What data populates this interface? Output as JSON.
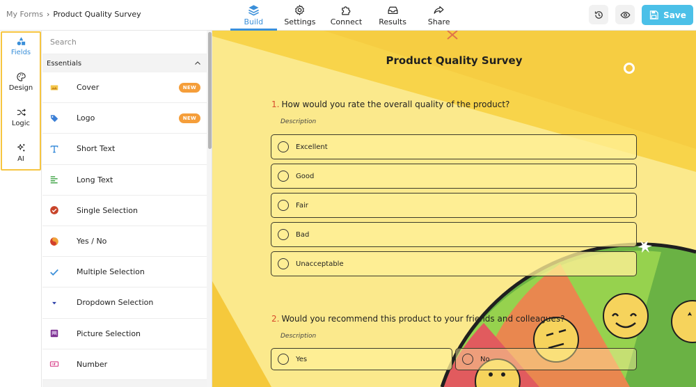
{
  "breadcrumb": {
    "root": "My Forms",
    "current": "Product Quality Survey"
  },
  "nav": {
    "tabs": [
      {
        "label": "Build",
        "icon": "layers-icon",
        "active": true
      },
      {
        "label": "Settings",
        "icon": "gear-icon",
        "active": false
      },
      {
        "label": "Connect",
        "icon": "puzzle-icon",
        "active": false
      },
      {
        "label": "Results",
        "icon": "inbox-icon",
        "active": false
      },
      {
        "label": "Share",
        "icon": "share-arrow-icon",
        "active": false
      }
    ]
  },
  "actions": {
    "history_icon": "history-icon",
    "preview_icon": "eye-icon",
    "save_label": "Save"
  },
  "rail": {
    "items": [
      {
        "label": "Fields",
        "icon": "shapes-icon",
        "active": true
      },
      {
        "label": "Design",
        "icon": "palette-icon",
        "active": false
      },
      {
        "label": "Logic",
        "icon": "shuffle-icon",
        "active": false
      },
      {
        "label": "AI",
        "icon": "sparkles-icon",
        "active": false
      }
    ]
  },
  "panel": {
    "search_placeholder": "Search",
    "section_title": "Essentials",
    "new_badge": "NEW",
    "fields": [
      {
        "label": "Cover",
        "icon": "image-icon",
        "badge": true
      },
      {
        "label": "Logo",
        "icon": "tag-icon",
        "badge": true
      },
      {
        "label": "Short Text",
        "icon": "text-t-icon",
        "badge": false
      },
      {
        "label": "Long Text",
        "icon": "align-left-icon",
        "badge": false
      },
      {
        "label": "Single Selection",
        "icon": "check-circle-icon",
        "badge": false
      },
      {
        "label": "Yes / No",
        "icon": "yin-yang-icon",
        "badge": false
      },
      {
        "label": "Multiple Selection",
        "icon": "checkmark-icon",
        "badge": false
      },
      {
        "label": "Dropdown Selection",
        "icon": "caret-down-icon",
        "badge": false
      },
      {
        "label": "Picture Selection",
        "icon": "picture-icon",
        "badge": false
      },
      {
        "label": "Number",
        "icon": "number-icon",
        "badge": false
      }
    ]
  },
  "survey": {
    "title": "Product Quality Survey",
    "questions": [
      {
        "number": "1.",
        "text": "How would you rate the overall quality of the product?",
        "description": "Description",
        "options": [
          "Excellent",
          "Good",
          "Fair",
          "Bad",
          "Unacceptable"
        ]
      },
      {
        "number": "2.",
        "text": "Would you recommend this product to your friends and colleagues?",
        "description": "Description",
        "options": [
          "Yes",
          "No"
        ]
      }
    ]
  },
  "colors": {
    "accent": "#3a8fd9",
    "save": "#4bc0e8",
    "badge": "#f59e3a",
    "canvas_yellow": "#f9de6c",
    "highlight": "#f6c540"
  }
}
